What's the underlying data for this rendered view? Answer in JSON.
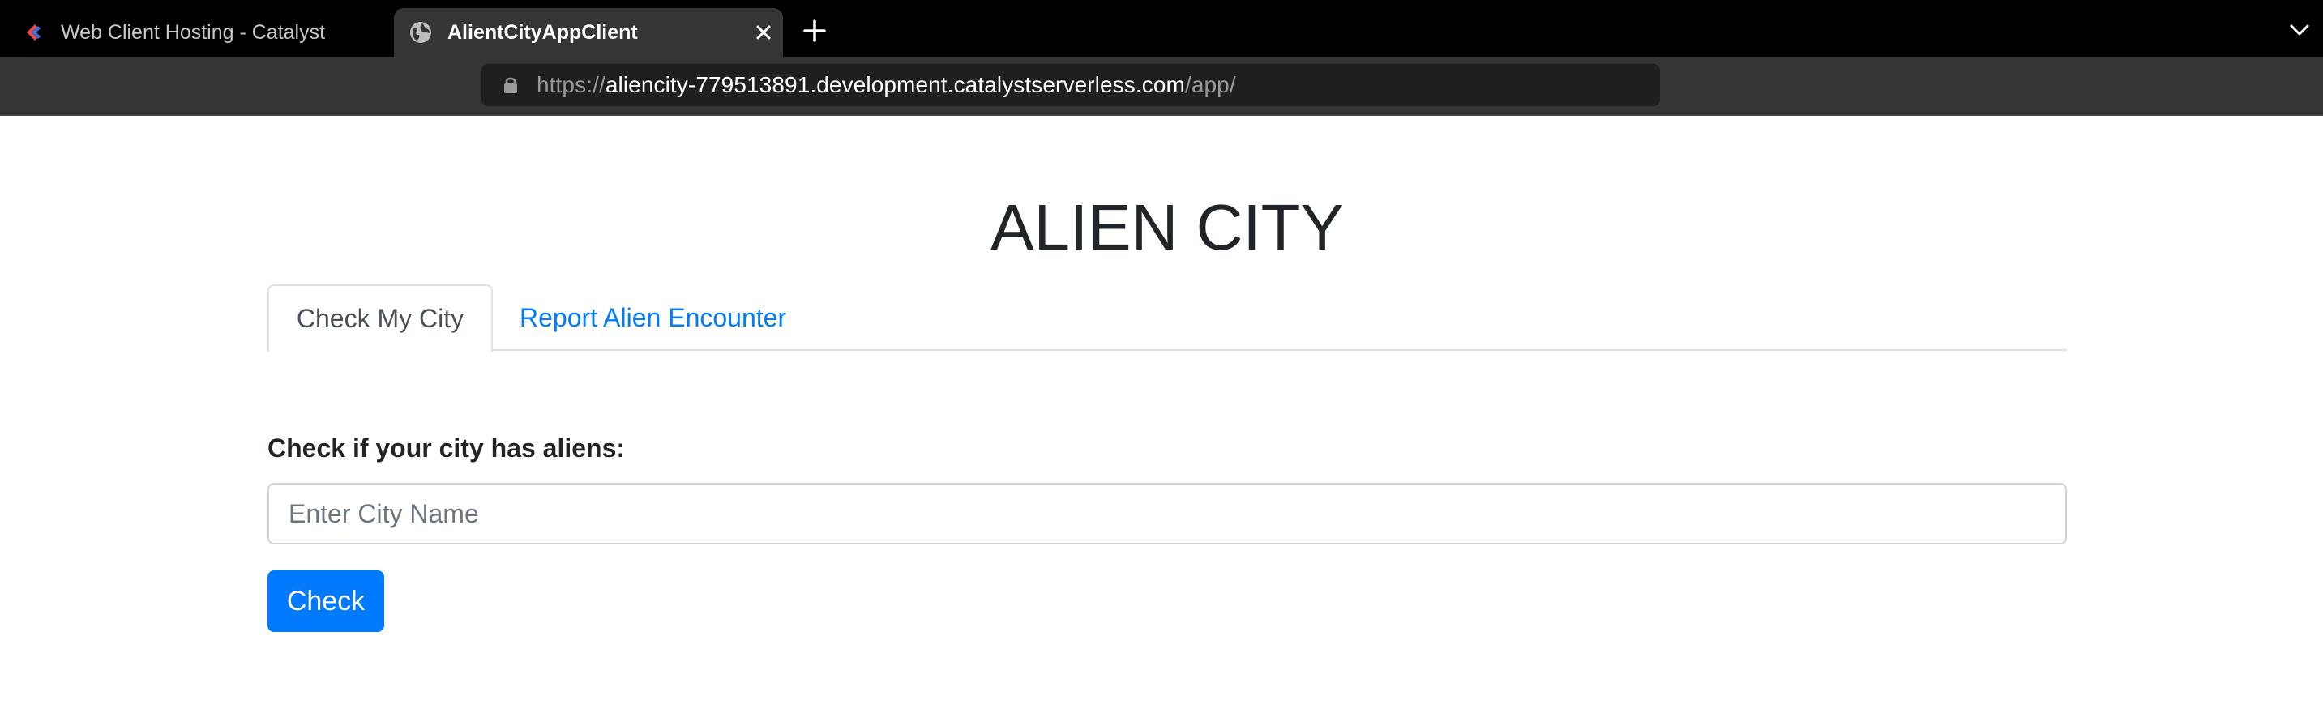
{
  "browser": {
    "tabs": [
      {
        "title": "Web Client Hosting - Catalyst",
        "active": false,
        "favicon": "catalyst-logo-icon"
      },
      {
        "title": "AlientCityAppClient",
        "active": true,
        "favicon": "globe-icon"
      }
    ],
    "url": {
      "scheme": "https://",
      "host": "aliencity-779513891.development.catalystserverless.com",
      "path": "/app/"
    }
  },
  "page": {
    "title": "ALIEN CITY",
    "tabs": [
      {
        "label": "Check My City",
        "active": true
      },
      {
        "label": "Report Alien Encounter",
        "active": false
      }
    ],
    "form": {
      "label": "Check if your city has aliens:",
      "input_placeholder": "Enter City Name",
      "input_value": "",
      "button_label": "Check"
    }
  },
  "colors": {
    "primary": "#007bff",
    "text": "#212529",
    "tab_text": "#495057",
    "border": "#dee2e6"
  }
}
